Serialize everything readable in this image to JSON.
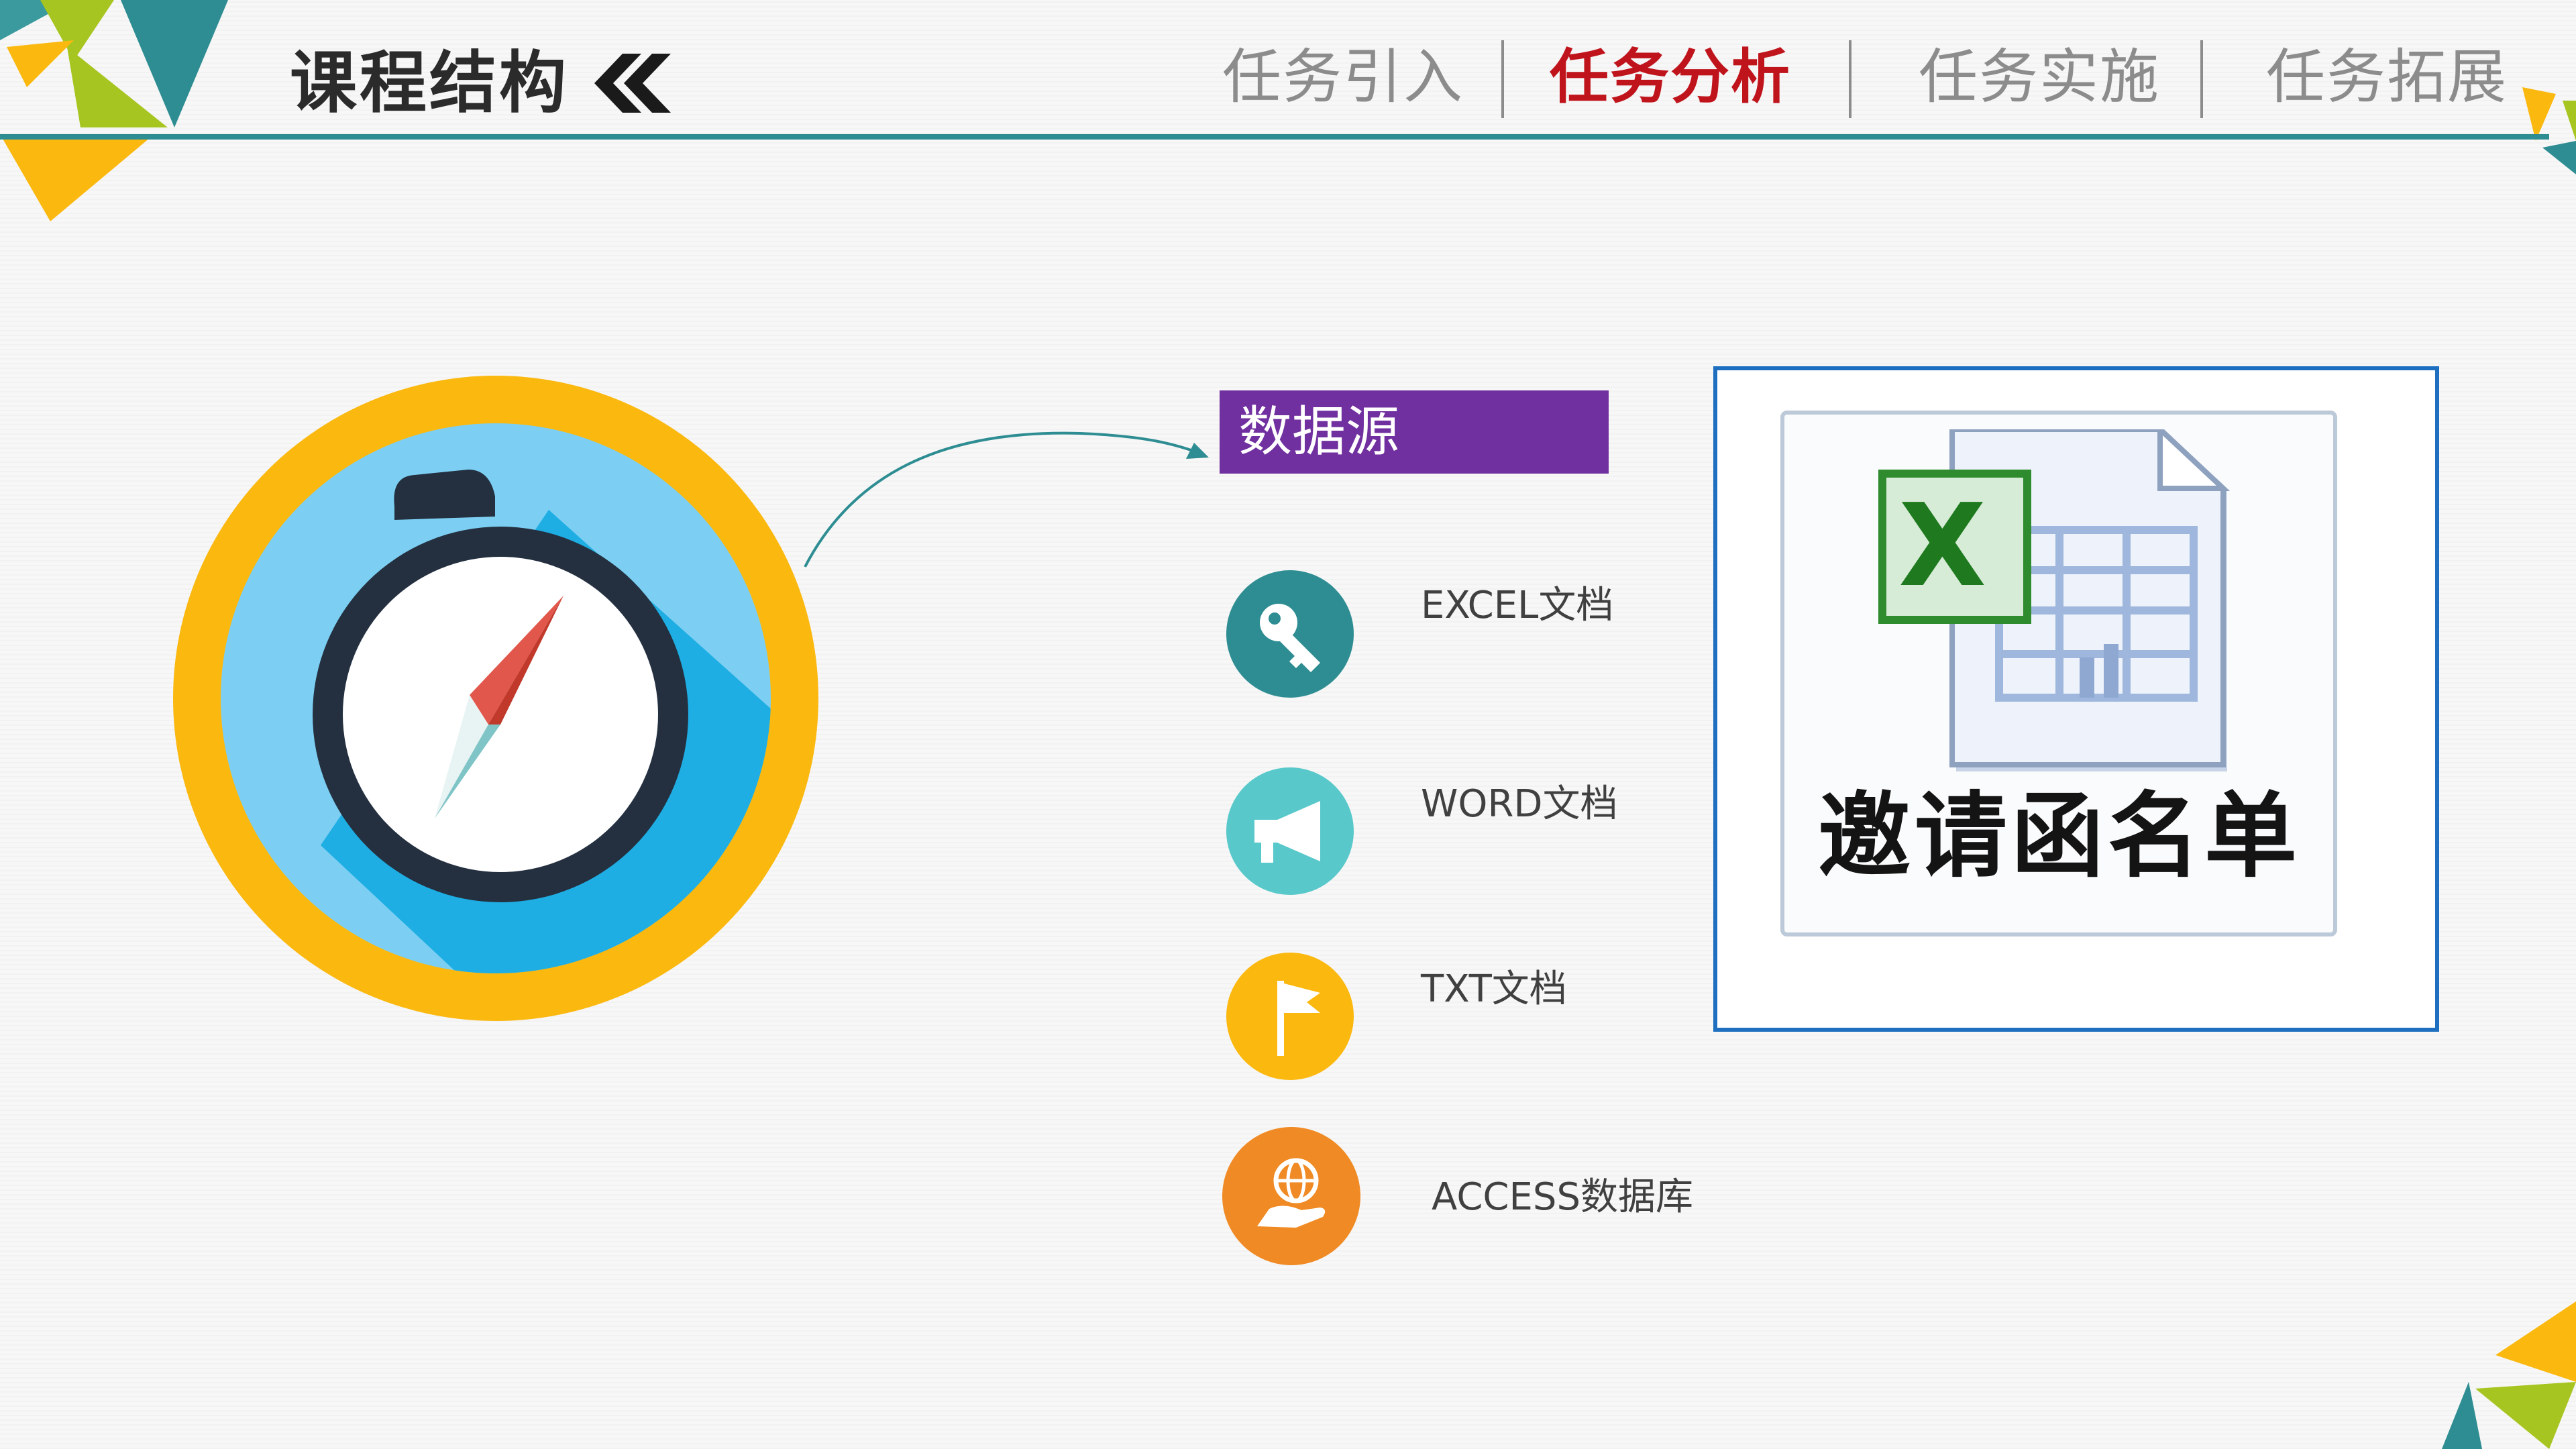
{
  "header": {
    "title": "课程结构",
    "chevron_icon": "double-chevron-left-icon",
    "nav": [
      {
        "label": "任务引入",
        "active": false
      },
      {
        "label": "任务分析",
        "active": true
      },
      {
        "label": "任务实施",
        "active": false
      },
      {
        "label": "任务拓展",
        "active": false
      }
    ]
  },
  "colors": {
    "accent_teal": "#2e8d92",
    "active_red": "#c0141c",
    "purple": "#7030a0",
    "yellow": "#fbb80f",
    "light_blue": "#7ccff2",
    "dark_navy": "#243040",
    "orange": "#f08a24",
    "cyan": "#58c8ca",
    "frame_blue": "#1e6fbf"
  },
  "main": {
    "compass_icon": "compass-stopwatch-icon",
    "data_source_label": "数据源",
    "sources": [
      {
        "label": "EXCEL文档",
        "icon": "key-icon",
        "color": "#2e8d92"
      },
      {
        "label": "WORD文档",
        "icon": "megaphone-icon",
        "color": "#58c8ca"
      },
      {
        "label": "TXT文档",
        "icon": "flag-icon",
        "color": "#fbb80f"
      },
      {
        "label": "ACCESS数据库",
        "icon": "globe-hand-icon",
        "color": "#f08a24"
      }
    ],
    "file": {
      "icon": "excel-file-icon",
      "caption": "邀请函名单"
    }
  }
}
